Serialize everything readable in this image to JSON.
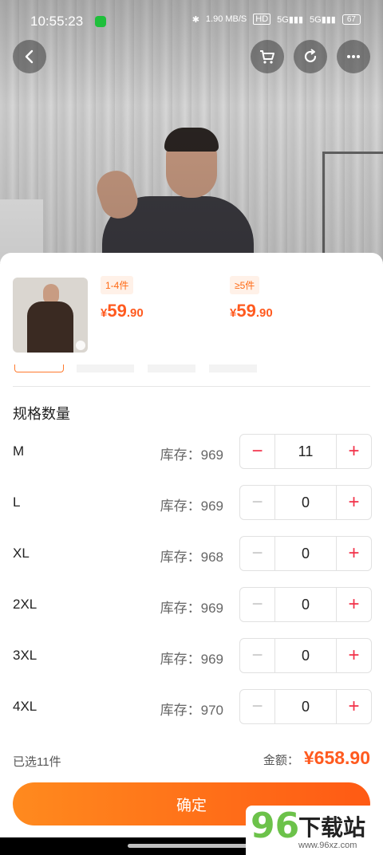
{
  "status_bar": {
    "time": "10:55:23",
    "net_speed": "1.90 MB/S",
    "hd": "HD",
    "sig1": "5G",
    "sig2": "5G",
    "battery": "67"
  },
  "header": {
    "back_icon": "chevron-left-icon",
    "cart_icon": "cart-icon",
    "share_icon": "refresh-icon",
    "more_icon": "more-dots-icon"
  },
  "price_tiers": [
    {
      "range": "1-4件",
      "yen": "¥",
      "int": "59",
      "dec": ".90"
    },
    {
      "range": "≥5件",
      "yen": "¥",
      "int": "59",
      "dec": ".90"
    }
  ],
  "spec_section_title": "规格数量",
  "stock_label": "库存：",
  "rows": [
    {
      "size": "M",
      "stock": "969",
      "qty": "11",
      "minus": "−",
      "plus": "+"
    },
    {
      "size": "L",
      "stock": "969",
      "qty": "0",
      "minus": "−",
      "plus": "+"
    },
    {
      "size": "XL",
      "stock": "968",
      "qty": "0",
      "minus": "−",
      "plus": "+"
    },
    {
      "size": "2XL",
      "stock": "969",
      "qty": "0",
      "minus": "−",
      "plus": "+"
    },
    {
      "size": "3XL",
      "stock": "969",
      "qty": "0",
      "minus": "−",
      "plus": "+"
    },
    {
      "size": "4XL",
      "stock": "970",
      "qty": "0",
      "minus": "−",
      "plus": "+"
    }
  ],
  "summary": {
    "selected": "已选11件",
    "amount_label": "金额：",
    "amount_value": "¥658.90"
  },
  "confirm_label": "确定",
  "watermark": {
    "num": "96",
    "text": "下载站",
    "url": "www.96xz.com"
  },
  "colors": {
    "accent": "#ff5a1f",
    "stepper_red": "#f23048"
  }
}
